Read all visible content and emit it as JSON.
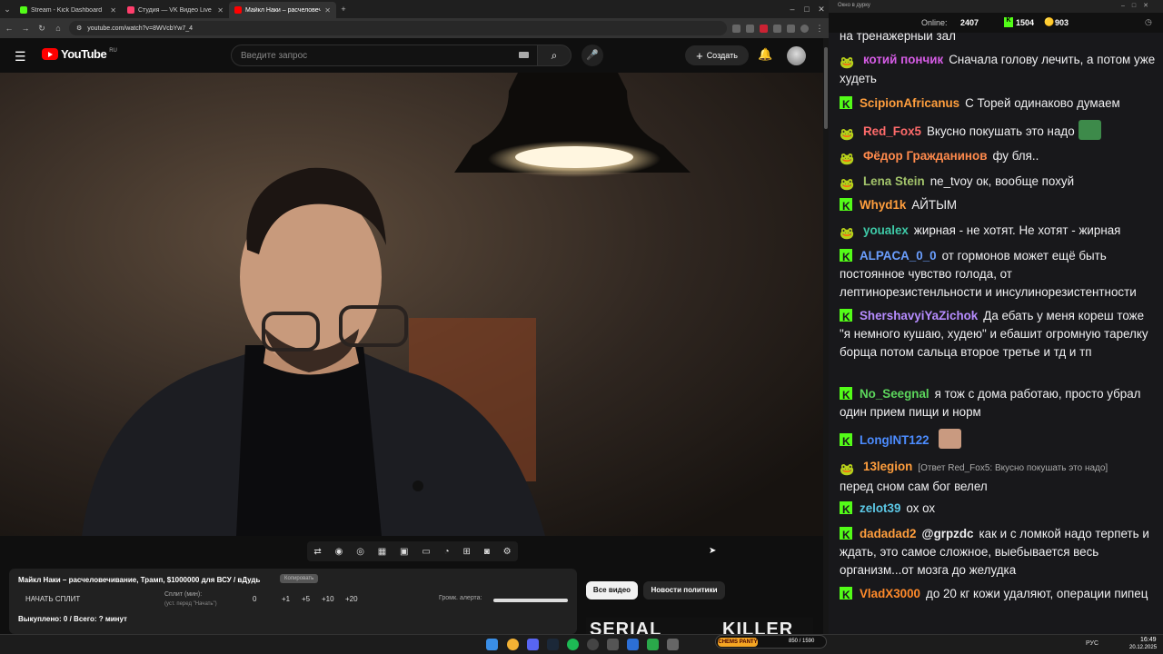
{
  "browser": {
    "tabs": [
      {
        "title": "Stream - Kick Dashboard",
        "fav_color": "#53fc18"
      },
      {
        "title": "Студия — VK Видео Live",
        "fav_color": "#ff3e6c"
      },
      {
        "title": "Майкл Наки – расчеловеч...",
        "fav_color": "#ff0000"
      }
    ],
    "new_tab": "+",
    "url": "youtube.com/watch?v=8WVcbYw7_4"
  },
  "youtube": {
    "logo_text": "YouTube",
    "region": "RU",
    "search_placeholder": "Введите запрос",
    "create_label": "Создать"
  },
  "split": {
    "title": "Майкл Наки – расчеловечивание, Трамп, $1000000 для ВСУ / вДудь",
    "badge": "Копировать",
    "start_label": "НАЧАТЬ СПЛИТ",
    "split_label": "Сплит (мин):",
    "split_sub": "(уст. перед \"Начать\")",
    "values": [
      "0",
      "+1",
      "+5",
      "+10",
      "+20"
    ],
    "volume_label": "Громк. алерта:",
    "volume_level": 1.0,
    "sold": "Выкуплено: 0 / Всего: ? минут"
  },
  "recommend": {
    "tabs": [
      "Все видео",
      "Новости политики"
    ],
    "thumb_text_1": "SERIAL",
    "thumb_text_2": "KILLER"
  },
  "chat": {
    "window_title": "Окно в дурку",
    "online_label": "Online:",
    "online_value": "2407",
    "kick_count": "1504",
    "vk_count": "903",
    "messages": [
      {
        "badge": "none",
        "user": "",
        "color": "#efeff1",
        "text": "на тренажерный зал"
      },
      {
        "badge": "vk",
        "user": "котий пончик",
        "color": "#d65ce6",
        "text": "Сначала голову лечить, а потом уже худеть"
      },
      {
        "badge": "kick",
        "user": "ScipionAfricanus",
        "color": "#ff9e3d",
        "text": "С Торей одинаково думаем"
      },
      {
        "badge": "vk",
        "user": "Red_Fox5",
        "color": "#ff6b6b",
        "text": "Вкусно покушать это надо"
      },
      {
        "badge": "vk",
        "user": "Фёдор Гражданинов",
        "color": "#ff8a4c",
        "text": "фу бля.."
      },
      {
        "badge": "vk",
        "user": "Lena Stein",
        "color": "#a3c46b",
        "text": "ne_tvoy ок, вообще похуй"
      },
      {
        "badge": "kick",
        "user": "Whyd1k",
        "color": "#ff9e3d",
        "text": "АЙТЫМ"
      },
      {
        "badge": "vk",
        "user": "youalex",
        "color": "#3ec9a7",
        "text": "жирная - не хотят. Не хотят - жирная"
      },
      {
        "badge": "kick",
        "user": "ALPACA_0_0",
        "color": "#6b9fff",
        "text": "от гормонов может ещё быть постоянное чувство голода, от лептинорезистенльности и инсулинорезистентности"
      },
      {
        "badge": "kick",
        "user": "ShershavyiYaZichok",
        "color": "#b68cff",
        "text": "Да ебать у меня кореш тоже \"я немного кушаю, худею\" и ебашит огромную тарелку борща потом сальца второе третье и тд и тп"
      },
      {
        "badge": "kick",
        "user": "No_Seegnal",
        "color": "#5cd65c",
        "text": "я тож с дома работаю, просто убрал один прием пищи и норм"
      },
      {
        "badge": "kick",
        "user": "LongINT122",
        "color": "#4c8cff",
        "text": ""
      },
      {
        "badge": "vk",
        "user": "13legion",
        "color": "#ff9e3d",
        "reply": "[Ответ Red_Fox5: Вкусно покушать это надо]",
        "text": "перед сном сам бог велел"
      },
      {
        "badge": "kick",
        "user": "zelot39",
        "color": "#5cc8e6",
        "text": "ох ох"
      },
      {
        "badge": "kick",
        "user": "dadadad2",
        "color": "#ff9e3d",
        "mention": "@grpzdc",
        "text": "как и с ломкой надо терпеть и ждать, это самое сложное, выебывается весь организм...от мозга до желудка"
      },
      {
        "badge": "kick",
        "user": "VladX3000",
        "color": "#ff8a2a",
        "text": "до 20 кг кожи удаляют, операции пипец"
      }
    ]
  },
  "taskbar": {
    "lang": "РУС",
    "time": "16:49",
    "date": "20.12.2025",
    "mem_label": "CHEMS PANTY",
    "mem_value": "850 / 1590"
  }
}
